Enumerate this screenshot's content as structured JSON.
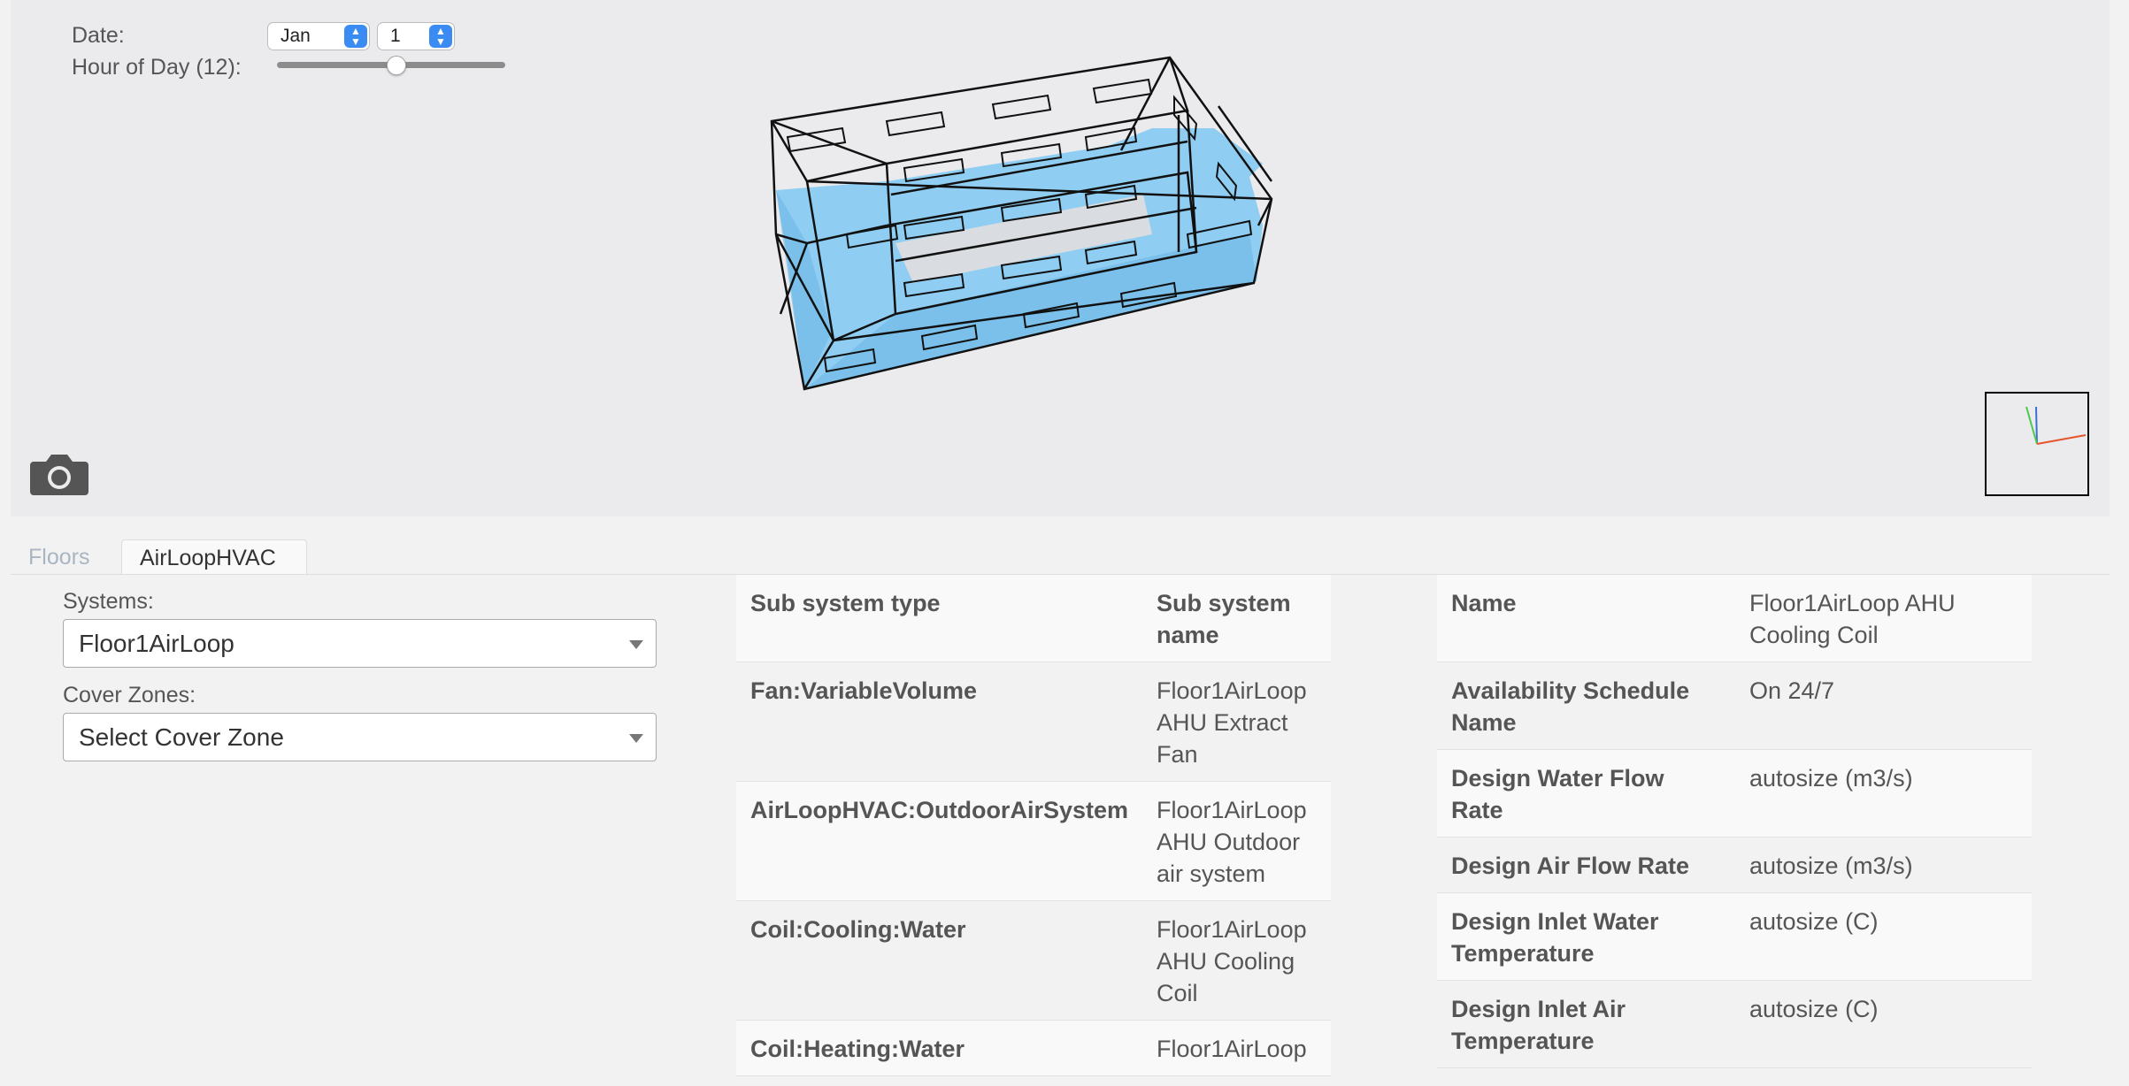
{
  "controls": {
    "date_label": "Date:",
    "month_value": "Jan",
    "day_value": "1",
    "hour_label": "Hour of Day (12):",
    "hour_value": 12,
    "hour_max": 23
  },
  "icons": {
    "camera": "camera-icon",
    "axes": "axes-gizmo"
  },
  "tabs": [
    {
      "label": "Floors",
      "active": false
    },
    {
      "label": "AirLoopHVAC",
      "active": true
    }
  ],
  "form": {
    "systems_label": "Systems:",
    "systems_value": "Floor1AirLoop",
    "cover_zones_label": "Cover Zones:",
    "cover_zones_value": "Select Cover Zone"
  },
  "subsystems": {
    "headers": [
      "Sub system type",
      "Sub system name"
    ],
    "rows": [
      {
        "type": "Fan:VariableVolume",
        "name": "Floor1AirLoop AHU Extract Fan"
      },
      {
        "type": "AirLoopHVAC:OutdoorAirSystem",
        "name": "Floor1AirLoop AHU Outdoor air system"
      },
      {
        "type": "Coil:Cooling:Water",
        "name": "Floor1AirLoop AHU Cooling Coil"
      },
      {
        "type": "Coil:Heating:Water",
        "name": "Floor1AirLoop"
      }
    ]
  },
  "properties": {
    "rows": [
      {
        "key": "Name",
        "value": "Floor1AirLoop AHU Cooling Coil"
      },
      {
        "key": "Availability Schedule Name",
        "value": "On 24/7"
      },
      {
        "key": "Design Water Flow Rate",
        "value": "autosize (m3/s)"
      },
      {
        "key": "Design Air Flow Rate",
        "value": "autosize (m3/s)"
      },
      {
        "key": "Design Inlet Water Temperature",
        "value": "autosize (C)"
      },
      {
        "key": "Design Inlet Air Temperature",
        "value": "autosize (C)"
      }
    ]
  },
  "colors": {
    "viewer_bg": "#ebebed",
    "zone_fill": "#7fc9f2",
    "accent": "#3b8cf2"
  }
}
